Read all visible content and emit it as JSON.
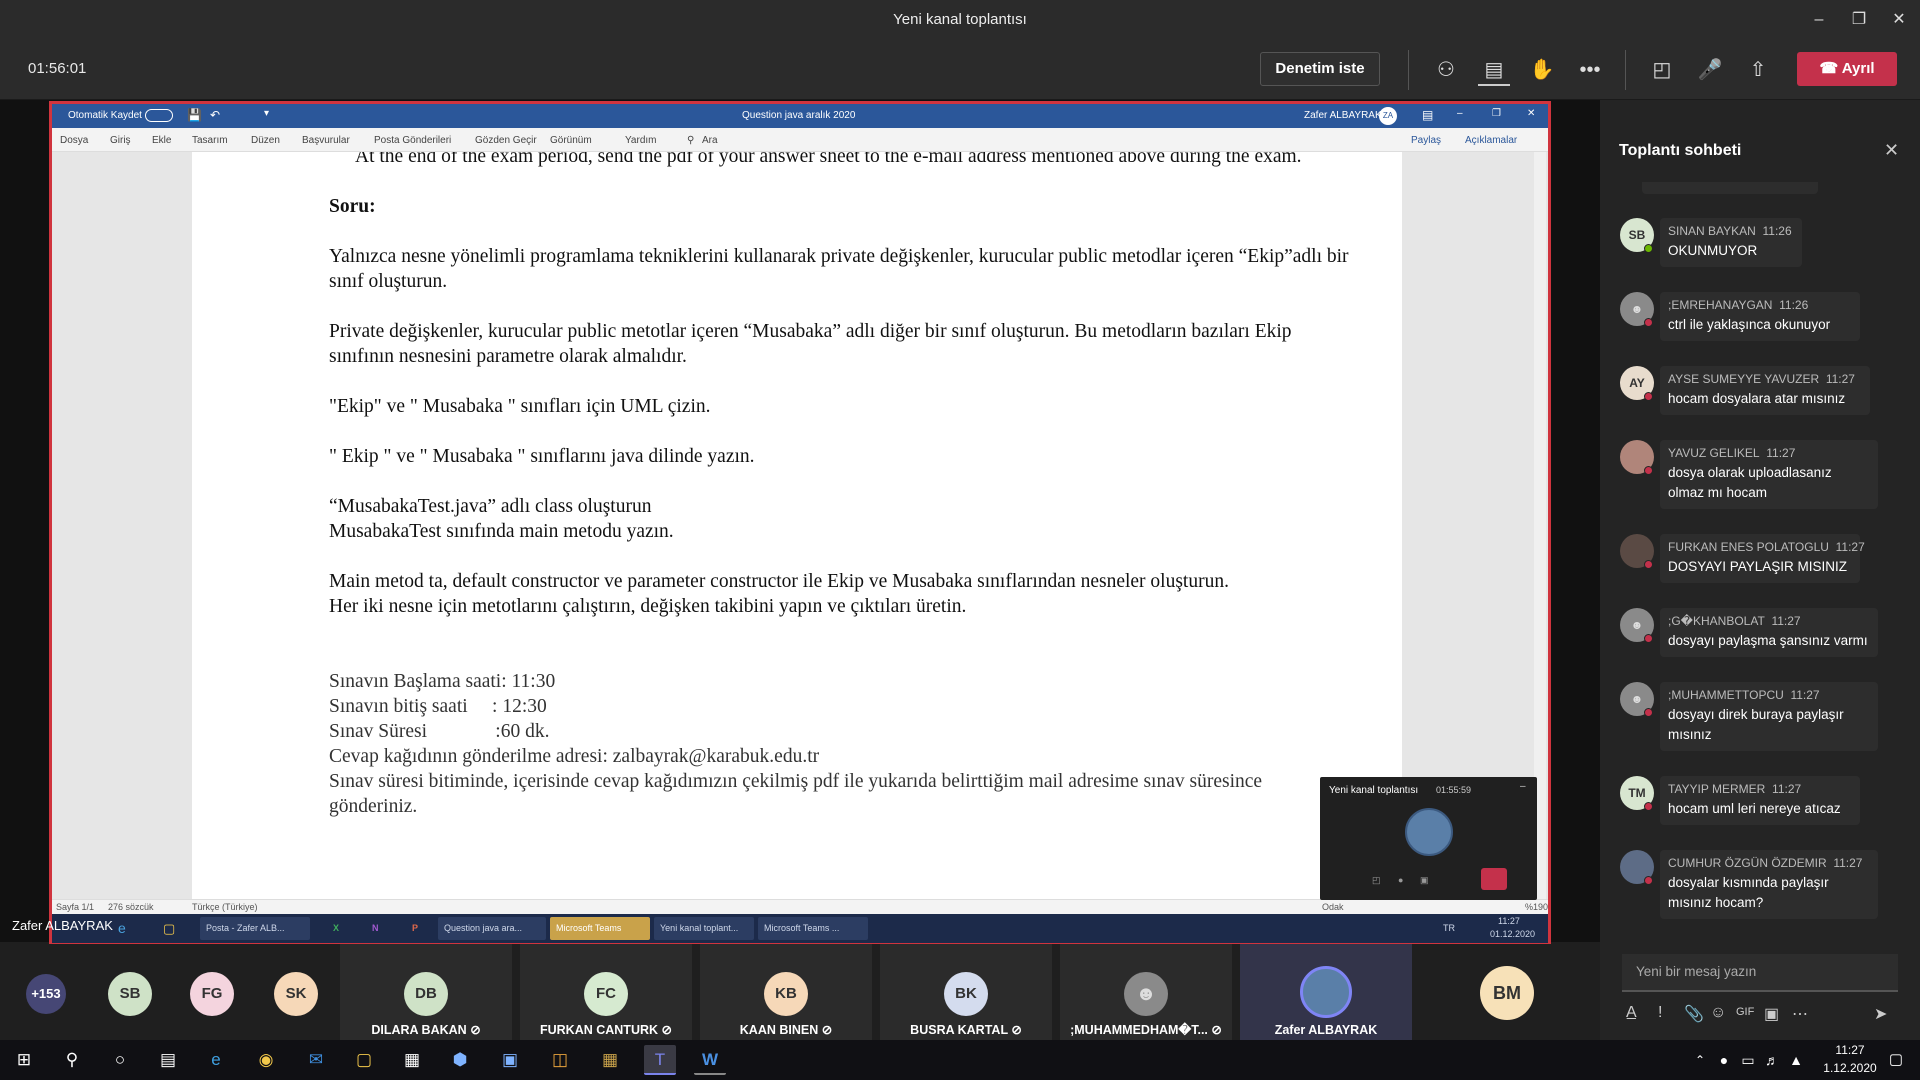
{
  "window": {
    "title": "Yeni kanal toplantısı"
  },
  "meeting": {
    "timer": "01:56:01",
    "control_label": "Denetim iste",
    "leave_label": "Ayrıl"
  },
  "presenter_name": "Zafer ALBAYRAK",
  "word": {
    "autosave_label": "Otomatik Kaydet",
    "doc_title": "Question java aralık 2020",
    "user": "Zafer ALBAYRAK",
    "user_initials": "ZA",
    "tabs": [
      "Dosya",
      "Giriş",
      "Ekle",
      "Tasarım",
      "Düzen",
      "Başvurular",
      "Posta Gönderileri",
      "Gözden Geçir",
      "Görünüm",
      "Yardım"
    ],
    "search_label": "Ara",
    "share_label": "Paylaş",
    "comments_label": "Açıklamalar",
    "status": {
      "page": "Sayfa 1/1",
      "words": "276 sözcük",
      "lang": "Türkçe (Türkiye)",
      "focus": "Odak",
      "zoom": "%190"
    }
  },
  "document": {
    "intro": "At the end of the exam period, send the pdf of your answer sheet to the e-mail address mentioned above during the exam.",
    "heading": "Soru:",
    "p1": "Yalnızca nesne yönelimli programlama tekniklerini kullanarak private değişkenler, kurucular public metodlar içeren “Ekip”adlı bir sınıf oluşturun.",
    "p2": "Private değişkenler, kurucular public metotlar içeren “Musabaka” adlı diğer bir sınıf oluşturun. Bu metodların bazıları Ekip sınıfının nesnesini parametre olarak almalıdır.",
    "p3": "\"Ekip\" ve \" Musabaka \" sınıfları için UML çizin.",
    "p4": "\" Ekip \" ve \" Musabaka \" sınıflarını java dilinde yazın.",
    "p5a": " “MusabakaTest.java” adlı class oluşturun",
    "p5b": "MusabakaTest sınıfında main metodu yazın.",
    "p6": "Main metod ta, default constructor ve parameter constructor ile Ekip ve Musabaka sınıflarından nesneler oluşturun.",
    "p7": "Her iki nesne için metotlarını çalıştırın, değişken takibini yapın ve çıktıları üretin.",
    "info": [
      "Sınavın Başlama saati: 11:30",
      "Sınavın bitiş saati     : 12:30",
      "Sınav Süresi              :60 dk.",
      "Cevap kağıdının gönderilme adresi: zalbayrak@karabuk.edu.tr",
      "Sınav süresi bitiminde, içerisinde cevap kağıdımızın çekilmiş pdf ile yukarıda belirttiğim mail adresime sınav süresince gönderiniz."
    ]
  },
  "inner_taskbar": {
    "items": [
      "Posta - Zafer ALB...",
      "Question java ara...",
      "Microsoft Teams",
      "Yeni kanal toplant...",
      "Microsoft Teams ..."
    ],
    "lang": "TR",
    "time": "11:27",
    "date": "01.12.2020"
  },
  "pip": {
    "title": "Yeni kanal toplantısı",
    "timer": "01:55:59"
  },
  "chat": {
    "title": "Toplantı sohbeti",
    "messages": [
      {
        "name": "SINAN BAYKAN",
        "time": "11:26",
        "text": "OKUNMUYOR",
        "initials": "SB"
      },
      {
        "name": ";EMREHANAYGAN",
        "time": "11:26",
        "text": "ctrl ile yaklaşınca okunuyor",
        "initials": ""
      },
      {
        "name": "AYSE SUMEYYE YAVUZER",
        "time": "11:27",
        "text": "hocam dosyalara atar mısınız",
        "initials": "AY"
      },
      {
        "name": "YAVUZ GELIKEL",
        "time": "11:27",
        "text": "dosya olarak uploadlasanız olmaz mı hocam",
        "initials": ""
      },
      {
        "name": "FURKAN ENES POLATOGLU",
        "time": "11:27",
        "text": "DOSYAYI PAYLAŞIR MISINIZ",
        "initials": ""
      },
      {
        "name": ";G�KHANBOLAT",
        "time": "11:27",
        "text": "dosyayı paylaşma şansınız varmı",
        "initials": ""
      },
      {
        "name": ";MUHAMMETTOPCU",
        "time": "11:27",
        "text": "dosyayı direk buraya paylaşır mısınız",
        "initials": ""
      },
      {
        "name": "TAYYIP MERMER",
        "time": "11:27",
        "text": "hocam uml leri nereye atıcaz",
        "initials": "TM"
      },
      {
        "name": "CUMHUR ÖZGÜN ÖZDEMIR",
        "time": "11:27",
        "text": "dosyalar kısmında paylaşır mısınız hocam?",
        "initials": ""
      }
    ],
    "input_placeholder": "Yeni bir mesaj yazın"
  },
  "participants": {
    "overflow": "+153",
    "small": [
      "SB",
      "FG",
      "SK"
    ],
    "tiles": [
      {
        "initials": "DB",
        "name": "DILARA BAKAN"
      },
      {
        "initials": "FC",
        "name": "FURKAN CANTURK"
      },
      {
        "initials": "KB",
        "name": "KAAN BINEN"
      },
      {
        "initials": "BK",
        "name": "BUSRA KARTAL"
      },
      {
        "initials": "",
        "name": ";MUHAMMEDHAM�T..."
      },
      {
        "initials": "",
        "name": "Zafer ALBAYRAK"
      }
    ],
    "last": "BM"
  },
  "taskbar": {
    "time": "11:27",
    "date": "1.12.2020"
  },
  "colors": {
    "leave": "#c4314b",
    "word_blue": "#2b579a",
    "share_border": "#d0343e"
  }
}
